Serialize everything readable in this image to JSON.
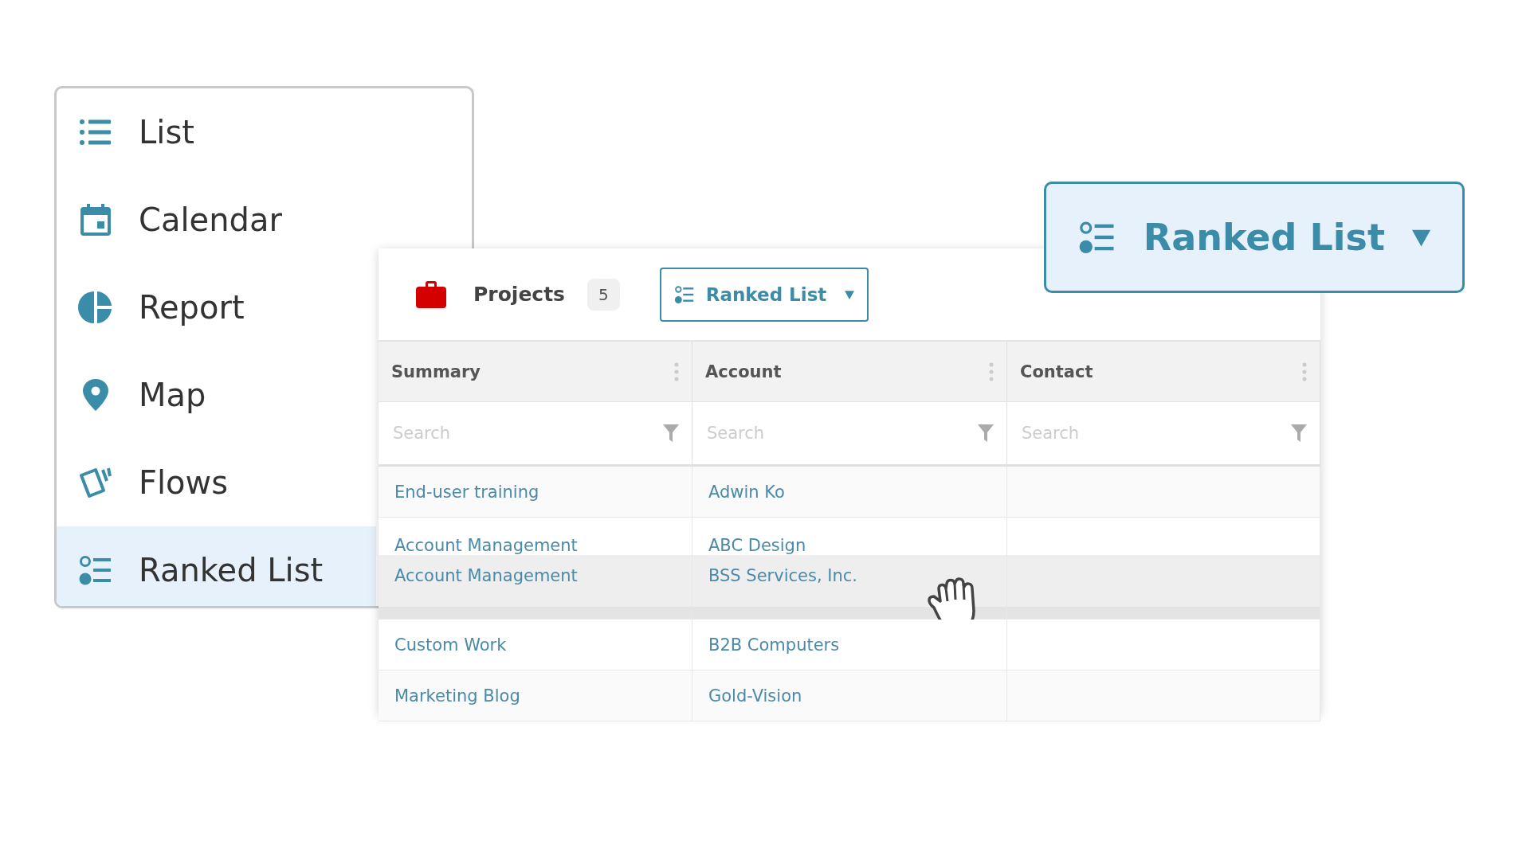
{
  "menu": {
    "items": [
      {
        "label": "List",
        "kind": "list",
        "selected": false
      },
      {
        "label": "Calendar",
        "kind": "calendar",
        "selected": false
      },
      {
        "label": "Report",
        "kind": "report",
        "selected": false
      },
      {
        "label": "Map",
        "kind": "map",
        "selected": false
      },
      {
        "label": "Flows",
        "kind": "flows",
        "selected": false
      },
      {
        "label": "Ranked List",
        "kind": "ranked",
        "selected": true
      }
    ]
  },
  "projects": {
    "title": "Projects",
    "count": "5",
    "view_button": {
      "label": "Ranked List"
    }
  },
  "table": {
    "columns": [
      {
        "label": "Summary",
        "placeholder": "Search"
      },
      {
        "label": "Account",
        "placeholder": "Search"
      },
      {
        "label": "Contact",
        "placeholder": "Search"
      }
    ],
    "rows": [
      {
        "kind": "normal",
        "summary": "End-user training",
        "account": "Adwin Ko"
      },
      {
        "kind": "covered",
        "summary": "Account Management",
        "account": "ABC Design"
      },
      {
        "kind": "dragging",
        "summary": "Account Management",
        "account": "BSS Services, Inc."
      },
      {
        "kind": "normal",
        "summary": "Custom Work",
        "account": "B2B Computers"
      },
      {
        "kind": "normal",
        "summary": "Marketing Blog",
        "account": "Gold-Vision"
      }
    ]
  },
  "view_selector": {
    "label": "Ranked List"
  }
}
